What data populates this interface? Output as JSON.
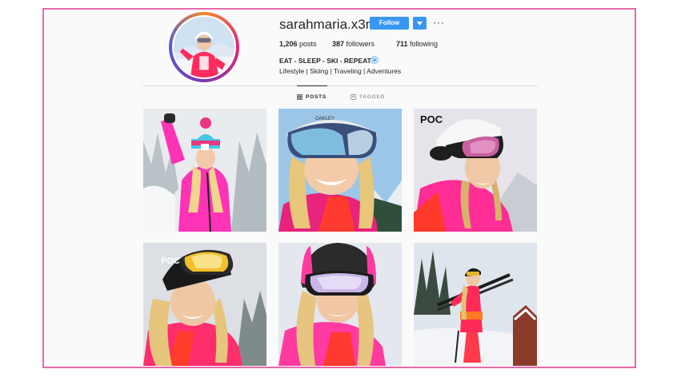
{
  "profile": {
    "username": "sarahmaria.x3na",
    "follow_label": "Follow",
    "more_label": "···",
    "stats": {
      "posts_count": "1,206",
      "posts_label": "posts",
      "followers_count": "387",
      "followers_label": "followers",
      "following_count": "711",
      "following_label": "following"
    },
    "bio_name": "EAT - SLEEP - SKI - REPEAT",
    "bio_line": "Lifestyle | Skiing | Traveling | Adventures"
  },
  "tabs": [
    {
      "label": "POSTS",
      "icon": "grid-icon",
      "active": true
    },
    {
      "label": "TAGGED",
      "icon": "tag-icon",
      "active": false
    }
  ],
  "posts": [
    {
      "alt": "skier in pink jacket with blue beanie in snowy forest",
      "jacket": "#ff3bb0"
    },
    {
      "alt": "closeup smiling skier with mirrored goggles",
      "jacket": "#e8247c"
    },
    {
      "alt": "skier with white POC helmet and pink goggles",
      "jacket": "#ff2f8a"
    },
    {
      "alt": "skier with black POC helmet and gold goggles",
      "jacket": "#ff2f6e"
    },
    {
      "alt": "skier with pink helmet and lilac goggles",
      "jacket": "#ff3aa0"
    },
    {
      "alt": "skier holding skis on slope",
      "jacket": "#ff2a55"
    }
  ],
  "colors": {
    "accent": "#3897f0",
    "frame": "#e66aa8",
    "text": "#262626"
  }
}
